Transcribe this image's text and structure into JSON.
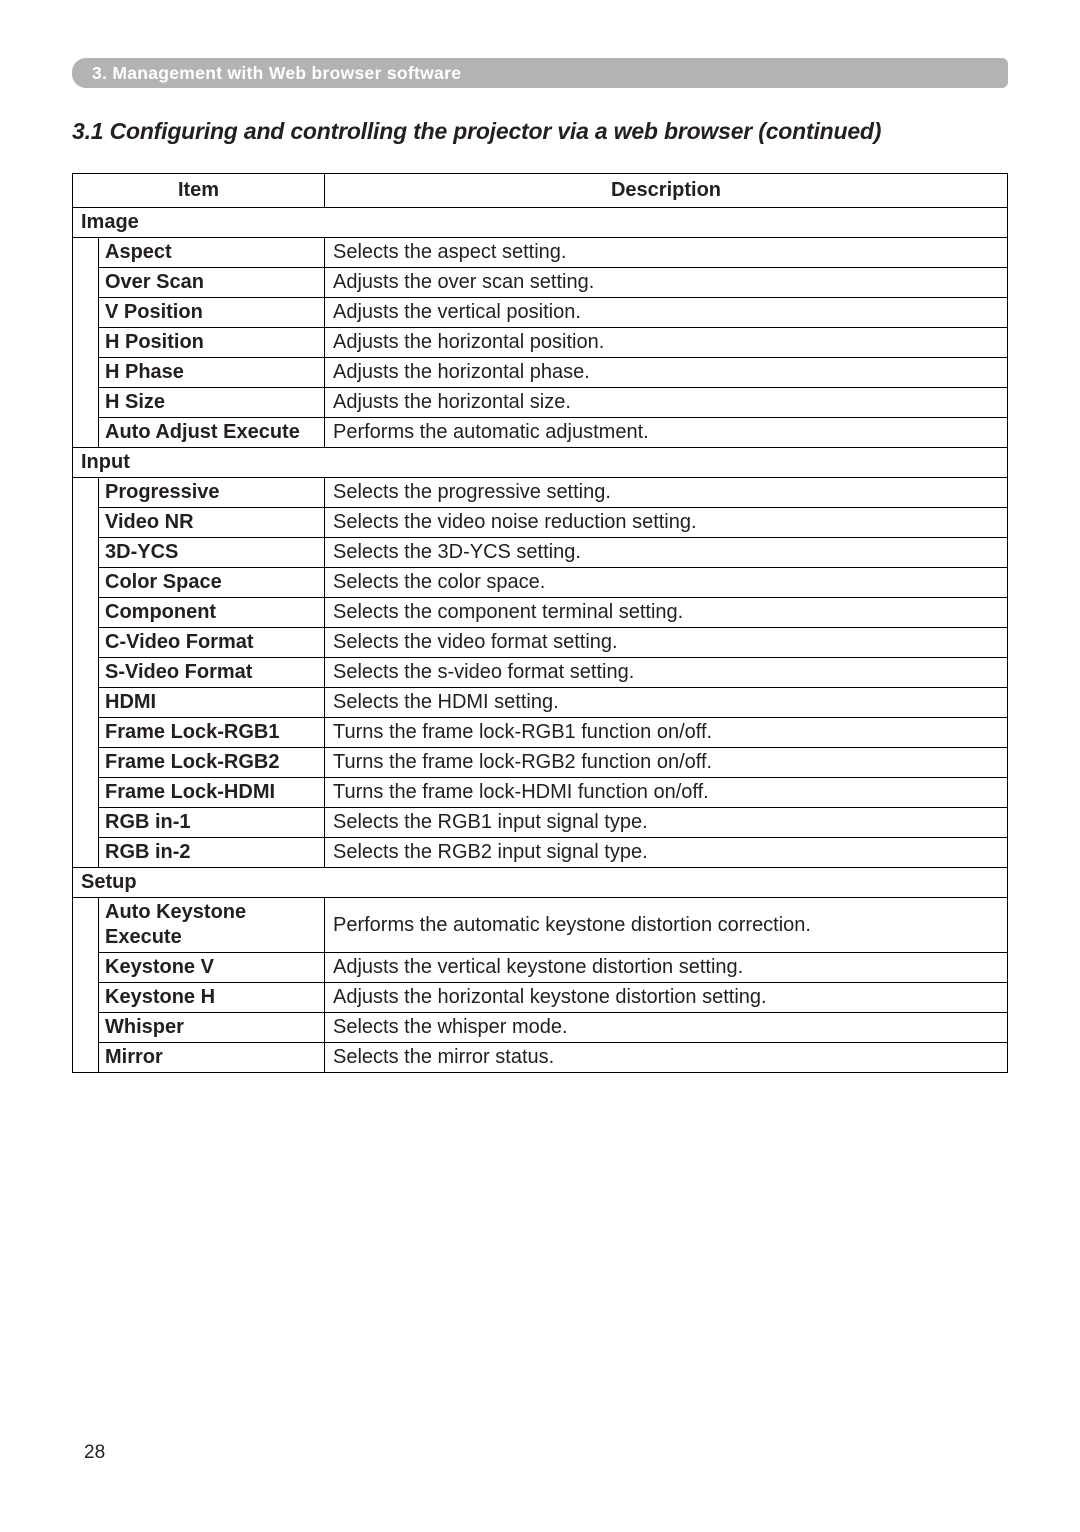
{
  "chapter_bar": "3. Management with Web browser software",
  "section_title": "3.1 Configuring and controlling the projector via a web browser (continued)",
  "headers": {
    "item": "Item",
    "description": "Description"
  },
  "groups": [
    {
      "title": "Image",
      "rows": [
        {
          "item": "Aspect",
          "desc": "Selects the aspect setting."
        },
        {
          "item": "Over Scan",
          "desc": "Adjusts the over scan setting."
        },
        {
          "item": "V Position",
          "desc": "Adjusts the vertical position."
        },
        {
          "item": "H Position",
          "desc": "Adjusts the horizontal position."
        },
        {
          "item": "H Phase",
          "desc": "Adjusts the horizontal phase."
        },
        {
          "item": "H Size",
          "desc": "Adjusts the horizontal size."
        },
        {
          "item": "Auto Adjust Execute",
          "desc": "Performs the automatic adjustment."
        }
      ]
    },
    {
      "title": "Input",
      "rows": [
        {
          "item": "Progressive",
          "desc": "Selects the progressive setting."
        },
        {
          "item": "Video NR",
          "desc": "Selects the video noise reduction setting."
        },
        {
          "item": "3D-YCS",
          "desc": "Selects the 3D-YCS setting."
        },
        {
          "item": "Color Space",
          "desc": "Selects the color space."
        },
        {
          "item": "Component",
          "desc": "Selects the component terminal setting."
        },
        {
          "item": "C-Video Format",
          "desc": "Selects the video format setting."
        },
        {
          "item": "S-Video Format",
          "desc": "Selects the s-video format setting."
        },
        {
          "item": "HDMI",
          "desc": "Selects the HDMI setting."
        },
        {
          "item": "Frame Lock-RGB1",
          "desc": "Turns the frame lock-RGB1 function on/off."
        },
        {
          "item": "Frame Lock-RGB2",
          "desc": "Turns the frame lock-RGB2 function on/off."
        },
        {
          "item": "Frame Lock-HDMI",
          "desc": "Turns the frame lock-HDMI function on/off."
        },
        {
          "item": "RGB in-1",
          "desc": "Selects the RGB1 input signal type."
        },
        {
          "item": "RGB in-2",
          "desc": "Selects the RGB2 input signal type."
        }
      ]
    },
    {
      "title": "Setup",
      "rows": [
        {
          "item": "Auto Keystone Execute",
          "desc": "Performs the automatic keystone distortion correction."
        },
        {
          "item": "Keystone V",
          "desc": "Adjusts the vertical keystone distortion setting."
        },
        {
          "item": "Keystone H",
          "desc": "Adjusts the horizontal keystone distortion setting."
        },
        {
          "item": "Whisper",
          "desc": "Selects the whisper mode."
        },
        {
          "item": "Mirror",
          "desc": "Selects the mirror status."
        }
      ]
    }
  ],
  "page_number": "28"
}
